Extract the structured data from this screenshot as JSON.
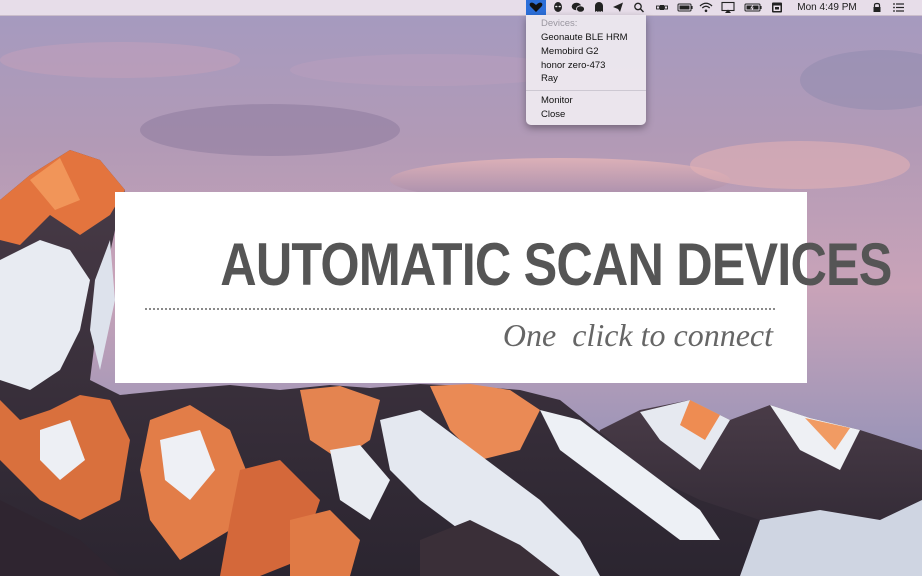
{
  "menubar": {
    "clock": "Mon 4:49 PM",
    "icons": [
      "heart-icon",
      "alien-icon",
      "wechat-icon",
      "ghost-icon",
      "paper-plane-icon",
      "search-icon",
      "satellite-icon",
      "battery-outline-icon",
      "wifi-icon",
      "airplay-icon",
      "battery-icon",
      "calendar-icon",
      "lock-icon",
      "list-icon"
    ]
  },
  "dropdown": {
    "header": "Devices:",
    "devices": [
      "Geonaute BLE HRM",
      "Memobird G2",
      "honor zero-473",
      "Ray"
    ],
    "actions": [
      "Monitor",
      "Close"
    ]
  },
  "banner": {
    "title": "AUTOMATIC SCAN DEVICES",
    "subtitle": "One  click to connect"
  },
  "colors": {
    "accent": "#2d6fd9",
    "banner_text": "#555555",
    "sky_top": "#9a8fb8",
    "mountain_glow": "#e3743e"
  }
}
